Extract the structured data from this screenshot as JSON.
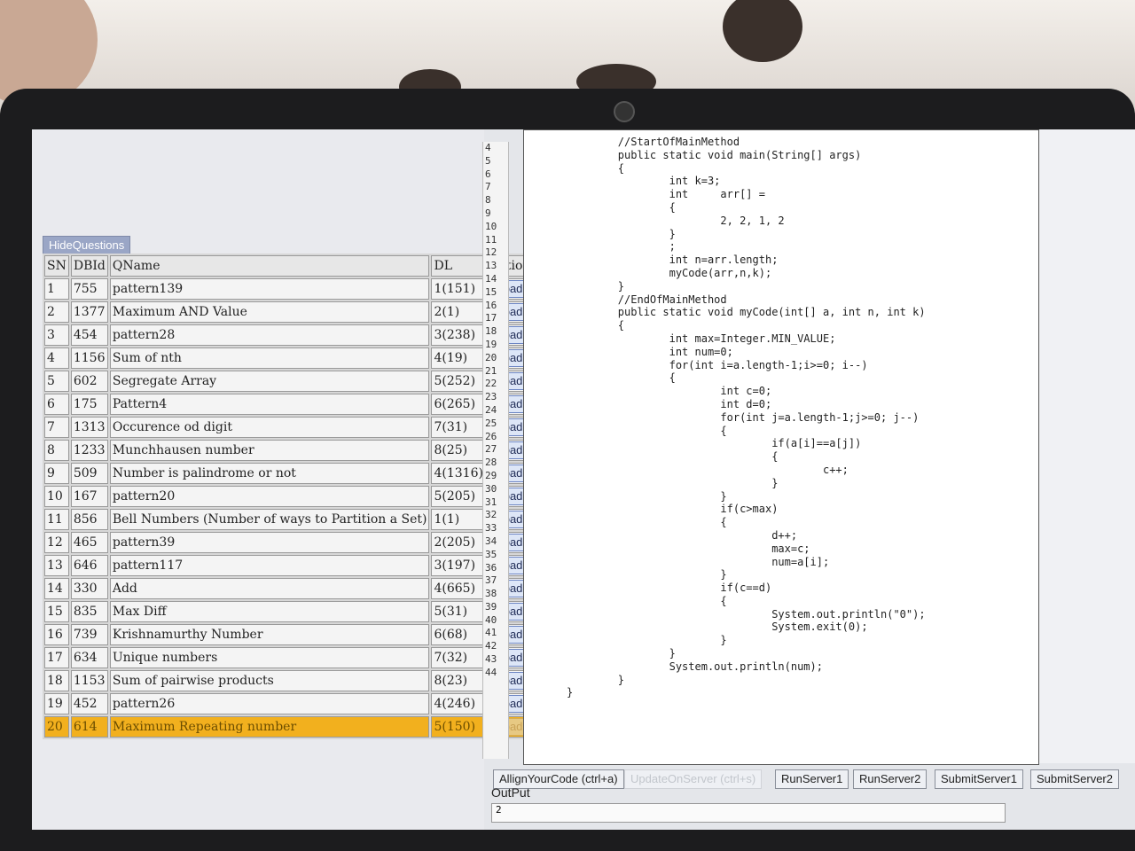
{
  "left_panel": {
    "hide_questions_label": "HideQuestions",
    "columns": [
      "SN",
      "DBId",
      "QName",
      "DL",
      "Action"
    ],
    "rows": [
      {
        "sn": "1",
        "dbid": "755",
        "qname": "pattern139",
        "dl": "1(151)",
        "action": "Load"
      },
      {
        "sn": "2",
        "dbid": "1377",
        "qname": "Maximum AND Value",
        "dl": "2(1)",
        "action": "Load"
      },
      {
        "sn": "3",
        "dbid": "454",
        "qname": "pattern28",
        "dl": "3(238)",
        "action": "Load"
      },
      {
        "sn": "4",
        "dbid": "1156",
        "qname": "Sum of nth",
        "dl": "4(19)",
        "action": "Load"
      },
      {
        "sn": "5",
        "dbid": "602",
        "qname": "Segregate Array",
        "dl": "5(252)",
        "action": "Load"
      },
      {
        "sn": "6",
        "dbid": "175",
        "qname": "Pattern4",
        "dl": "6(265)",
        "action": "Load"
      },
      {
        "sn": "7",
        "dbid": "1313",
        "qname": "Occurence od digit",
        "dl": "7(31)",
        "action": "Load"
      },
      {
        "sn": "8",
        "dbid": "1233",
        "qname": "Munchhausen number",
        "dl": "8(25)",
        "action": "Load"
      },
      {
        "sn": "9",
        "dbid": "509",
        "qname": "Number is palindrome or not",
        "dl": "4(1316)",
        "action": "Load"
      },
      {
        "sn": "10",
        "dbid": "167",
        "qname": "pattern20",
        "dl": "5(205)",
        "action": "Load"
      },
      {
        "sn": "11",
        "dbid": "856",
        "qname": "Bell Numbers (Number of ways to Partition a Set)",
        "dl": "1(1)",
        "action": "Load"
      },
      {
        "sn": "12",
        "dbid": "465",
        "qname": "pattern39",
        "dl": "2(205)",
        "action": "Load"
      },
      {
        "sn": "13",
        "dbid": "646",
        "qname": "pattern117",
        "dl": "3(197)",
        "action": "Load"
      },
      {
        "sn": "14",
        "dbid": "330",
        "qname": "Add",
        "dl": "4(665)",
        "action": "Load"
      },
      {
        "sn": "15",
        "dbid": "835",
        "qname": "Max Diff",
        "dl": "5(31)",
        "action": "Load"
      },
      {
        "sn": "16",
        "dbid": "739",
        "qname": "Krishnamurthy Number",
        "dl": "6(68)",
        "action": "Load"
      },
      {
        "sn": "17",
        "dbid": "634",
        "qname": "Unique numbers",
        "dl": "7(32)",
        "action": "Load"
      },
      {
        "sn": "18",
        "dbid": "1153",
        "qname": "Sum of pairwise products",
        "dl": "8(23)",
        "action": "Load"
      },
      {
        "sn": "19",
        "dbid": "452",
        "qname": "pattern26",
        "dl": "4(246)",
        "action": "Load"
      },
      {
        "sn": "20",
        "dbid": "614",
        "qname": "Maximum Repeating number",
        "dl": "5(150)",
        "action": "Load",
        "highlighted": true
      }
    ]
  },
  "editor": {
    "line_numbers": [
      "4",
      "5",
      "6",
      "7",
      "8",
      "9",
      "10",
      "11",
      "12",
      "13",
      "14",
      "15",
      "16",
      "17",
      "18",
      "19",
      "20",
      "21",
      "22",
      "23",
      "24",
      "25",
      "26",
      "27",
      "28",
      "29",
      "30",
      "31",
      "32",
      "33",
      "34",
      "35",
      "36",
      "37",
      "38",
      "39",
      "40",
      "41",
      "42",
      "43",
      "44"
    ],
    "code": "        //StartOfMainMethod\n        public static void main(String[] args)\n        {\n                int k=3;\n                int     arr[] =\n                {\n                        2, 2, 1, 2\n                }\n                ;\n                int n=arr.length;\n                myCode(arr,n,k);\n        }\n        //EndOfMainMethod\n        public static void myCode(int[] a, int n, int k)\n        {\n                int max=Integer.MIN_VALUE;\n                int num=0;\n                for(int i=a.length-1;i>=0; i--)\n                {\n                        int c=0;\n                        int d=0;\n                        for(int j=a.length-1;j>=0; j--)\n                        {\n                                if(a[i]==a[j])\n                                {\n                                        c++;\n                                }\n                        }\n                        if(c>max)\n                        {\n                                d++;\n                                max=c;\n                                num=a[i];\n                        }\n                        if(c==d)\n                        {\n                                System.out.println(\"0\");\n                                System.exit(0);\n                        }\n                }\n                System.out.println(num);\n        }\n}"
  },
  "toolbar": {
    "align_label": "AllignYourCode (ctrl+a)",
    "update_label": "UpdateOnServer (ctrl+s)",
    "run1_label": "RunServer1",
    "run2_label": "RunServer2",
    "submit1_label": "SubmitServer1",
    "submit2_label": "SubmitServer2"
  },
  "output": {
    "label": "OutPut",
    "value": "2"
  },
  "colors": {
    "highlight_row": "#f2b01e",
    "load_button": "#dde6f7",
    "hide_questions": "#9aa6c6"
  }
}
